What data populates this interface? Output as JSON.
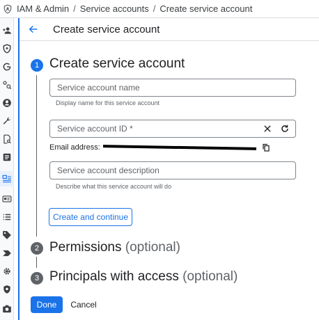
{
  "breadcrumb": {
    "items": [
      "IAM & Admin",
      "Service accounts",
      "Create service account"
    ],
    "separator": "/"
  },
  "header": {
    "title": "Create service account",
    "back_icon": "arrow-back-icon"
  },
  "rail": {
    "icons": [
      "add-person-icon",
      "shield-icon",
      "google-icon",
      "key-search-icon",
      "account-circle-icon",
      "wrench-icon",
      "document-search-icon",
      "list-doc-icon",
      "service-account-icon",
      "id-card-icon",
      "list-icon",
      "tag-icon",
      "label-arrow-icon",
      "gear-icon",
      "shield-check-icon",
      "camera-icon"
    ],
    "active_icon": "service-account-icon"
  },
  "steps": [
    {
      "number": "1",
      "title": "Create service account",
      "optional": "",
      "active": true
    },
    {
      "number": "2",
      "title": "Permissions",
      "optional": "(optional)",
      "active": false
    },
    {
      "number": "3",
      "title": "Principals with access",
      "optional": "(optional)",
      "active": false
    }
  ],
  "form": {
    "name_placeholder": "Service account name",
    "name_helper": "Display name for this service account",
    "id_placeholder": "Service account ID *",
    "email_label": "Email address:",
    "description_placeholder": "Service account description",
    "description_helper": "Describe what this service account will do"
  },
  "buttons": {
    "create_continue": "Create and continue",
    "done": "Done",
    "cancel": "Cancel"
  },
  "colors": {
    "accent": "#1a73e8",
    "text": "#202124",
    "muted": "#5f6368"
  }
}
